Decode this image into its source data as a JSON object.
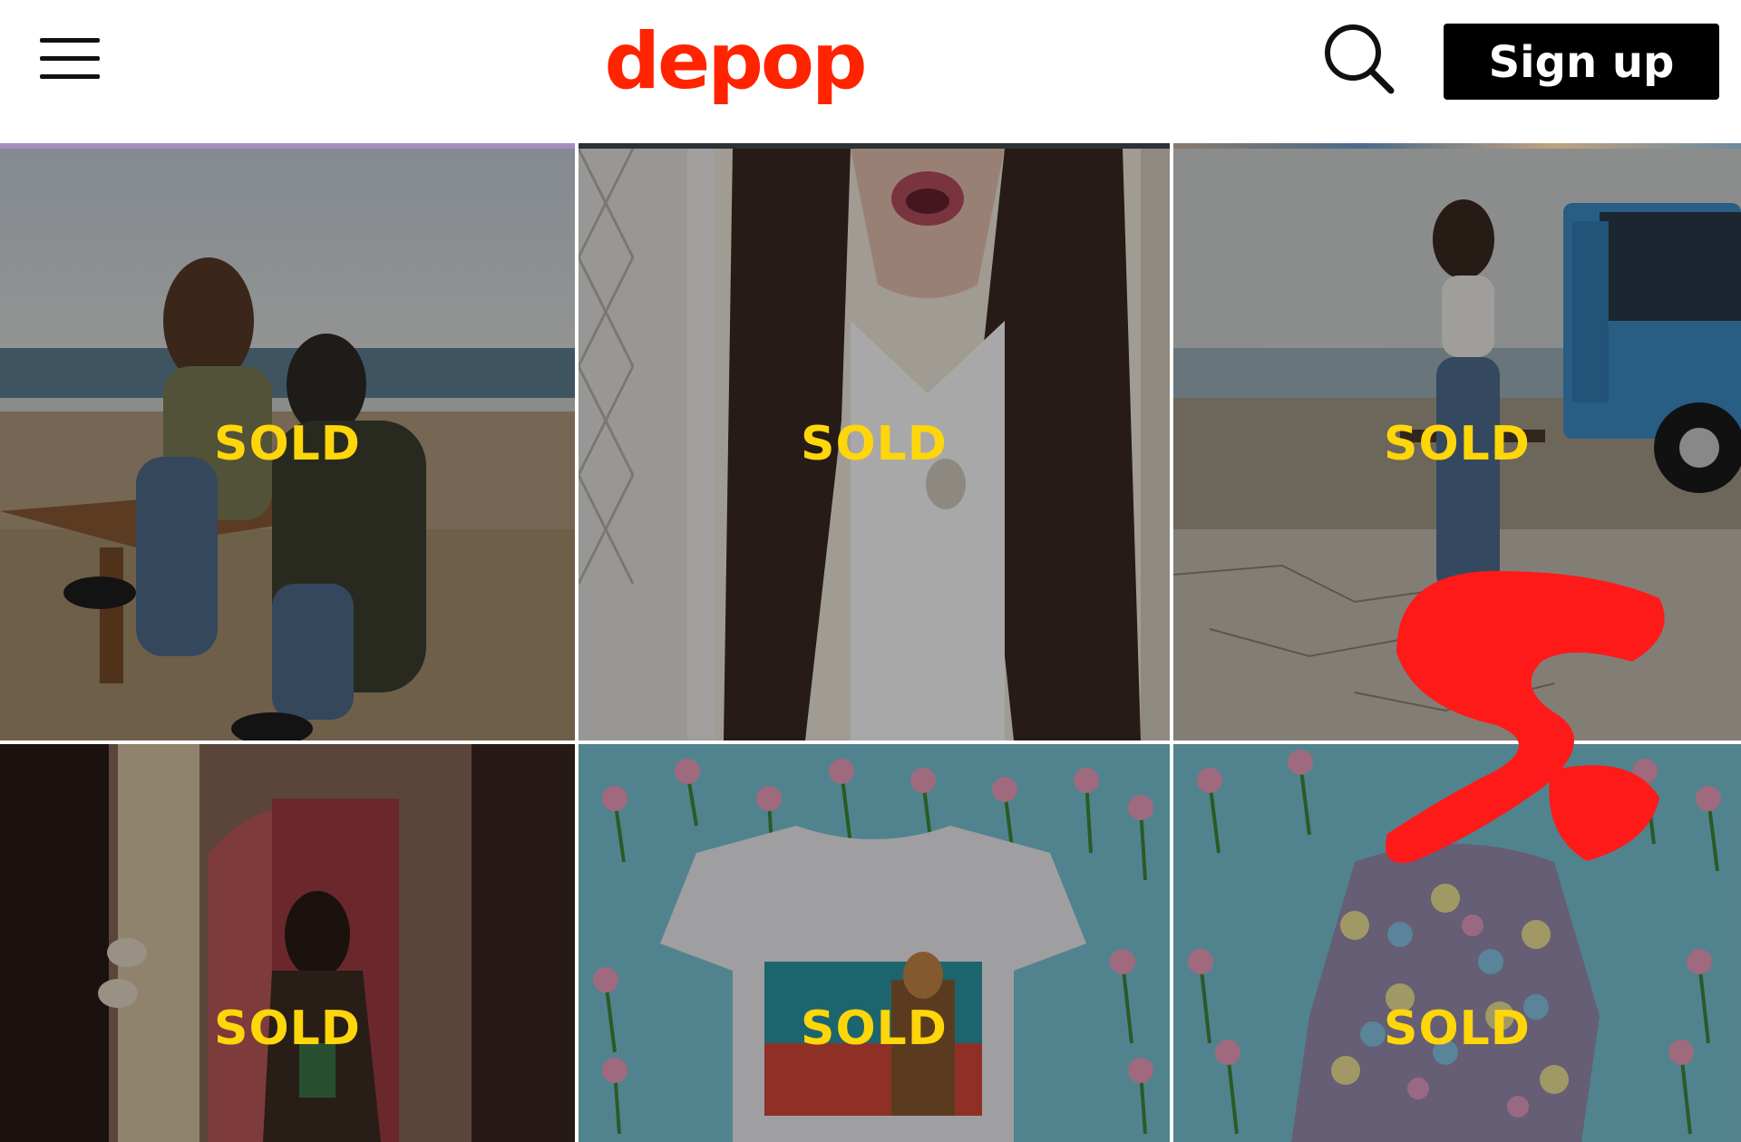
{
  "header": {
    "logo": "depop",
    "signup_label": "Sign up"
  },
  "icons": {
    "menu": "hamburger-menu-icon",
    "search": "search-icon",
    "overlay": "depop-swirl-graphic"
  },
  "colors": {
    "brand": "#ff2300",
    "sold_text": "#ffd60a",
    "signup_bg": "#000000"
  },
  "products": [
    {
      "status": "SOLD"
    },
    {
      "status": "SOLD"
    },
    {
      "status": "SOLD"
    },
    {
      "status": "SOLD"
    },
    {
      "status": "SOLD"
    },
    {
      "status": "SOLD"
    }
  ]
}
